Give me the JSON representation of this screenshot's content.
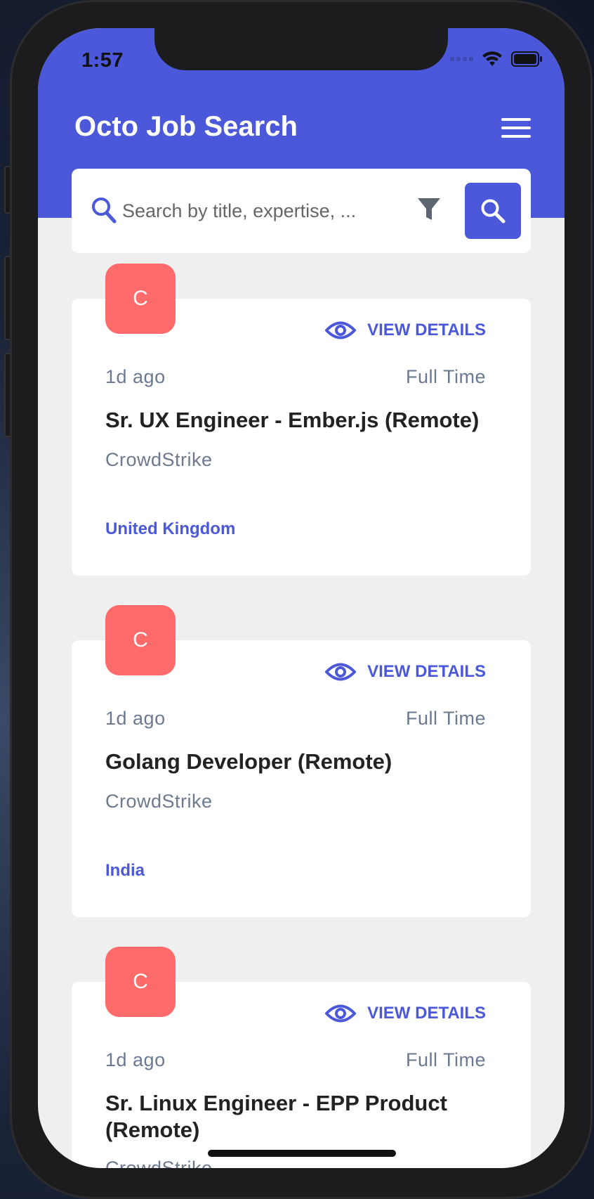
{
  "status_bar": {
    "time": "1:57"
  },
  "header": {
    "title": "Octo Job Search"
  },
  "search": {
    "placeholder": "Search by title, expertise, ..."
  },
  "jobs": [
    {
      "logo_letter": "C",
      "view_label": "VIEW DETAILS",
      "posted": "1d ago",
      "type": "Full Time",
      "title": "Sr. UX Engineer - Ember.js (Remote)",
      "company": "CrowdStrike",
      "location": "United Kingdom"
    },
    {
      "logo_letter": "C",
      "view_label": "VIEW DETAILS",
      "posted": "1d ago",
      "type": "Full Time",
      "title": "Golang Developer (Remote)",
      "company": "CrowdStrike",
      "location": "India"
    },
    {
      "logo_letter": "C",
      "view_label": "VIEW DETAILS",
      "posted": "1d ago",
      "type": "Full Time",
      "title": "Sr. Linux Engineer - EPP Product (Remote)",
      "company": "CrowdStrike",
      "location": ""
    }
  ],
  "colors": {
    "primary": "#4b58d9",
    "logo_bg": "#ff6b6b",
    "muted_text": "#6b7a90",
    "background": "#efefef"
  },
  "icons": {
    "search": "search-icon",
    "filter": "filter-icon",
    "menu": "hamburger-menu-icon",
    "view": "eye-icon"
  }
}
